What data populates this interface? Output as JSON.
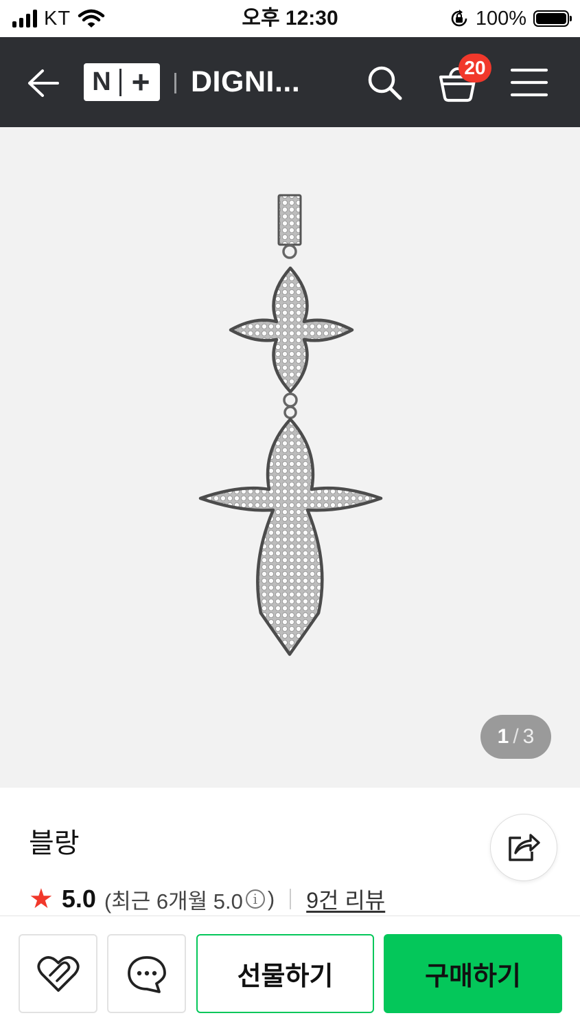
{
  "status_bar": {
    "carrier": "KT",
    "time": "오후 12:30",
    "battery_percent": "100%",
    "battery_level": 1.0,
    "icons": [
      "signal-icon",
      "wifi-icon",
      "orientation-lock-icon",
      "battery-icon"
    ]
  },
  "header": {
    "logo_n": "N",
    "logo_plus": "+",
    "store_title": "DIGNI...",
    "cart_count": "20",
    "icons": [
      "back-arrow-icon",
      "search-icon",
      "cart-icon",
      "menu-icon"
    ],
    "colors": {
      "background": "#2d2f33",
      "badge": "#f1382b"
    }
  },
  "gallery": {
    "current": "1",
    "separator": "/",
    "total": "3"
  },
  "product": {
    "name": "블랑",
    "rating": "5.0",
    "recent_prefix": "(최근 6개월 5.0",
    "recent_info_glyph": "i",
    "recent_suffix": ")",
    "review_link": "9건 리뷰"
  },
  "bottom_bar": {
    "gift_label": "선물하기",
    "buy_label": "구매하기",
    "icons": [
      "heart-icon",
      "chat-icon"
    ],
    "colors": {
      "accent": "#04c75a"
    }
  }
}
